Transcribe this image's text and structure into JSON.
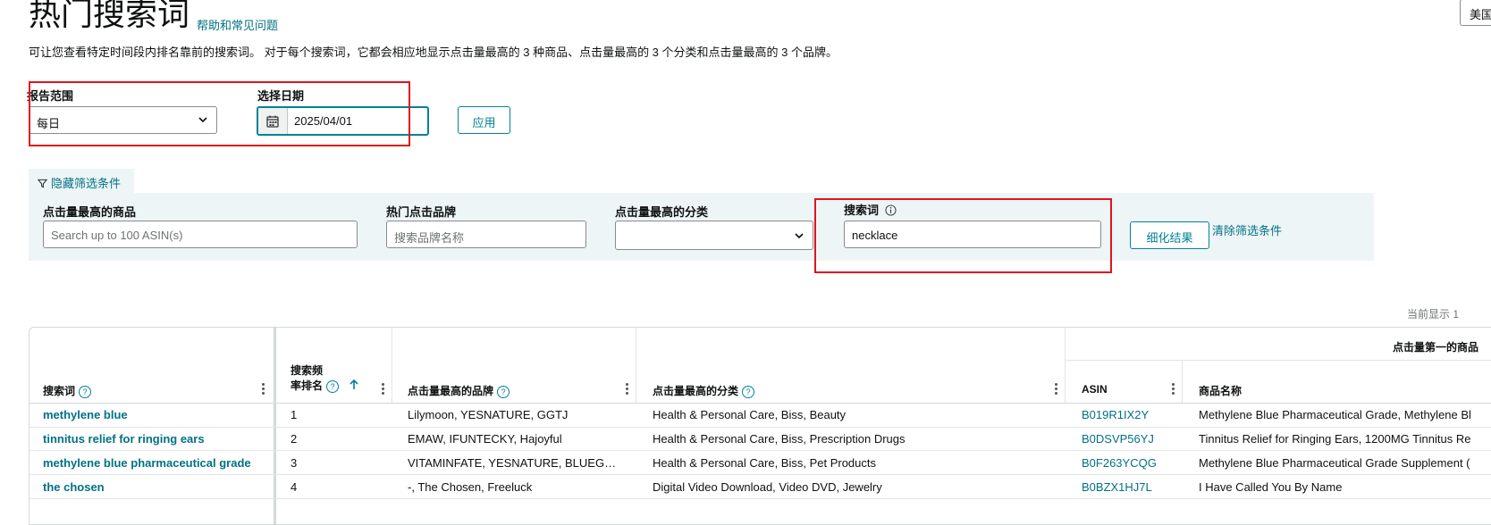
{
  "header": {
    "title": "热门搜索词",
    "help_link": "帮助和常见问题",
    "region_button": "美国",
    "description": "可让您查看特定时间段内排名靠前的搜索词。 对于每个搜索词，它都会相应地显示点击量最高的 3 种商品、点击量最高的 3 个分类和点击量最高的 3 个品牌。"
  },
  "report": {
    "range_label": "报告范围",
    "range_value": "每日",
    "date_label": "选择日期",
    "date_value": "2025/04/01",
    "apply_label": "应用"
  },
  "filters": {
    "toggle_label": "隐藏筛选条件",
    "product_label": "点击量最高的商品",
    "product_placeholder": "Search up to 100 ASIN(s)",
    "brand_label": "热门点击品牌",
    "brand_placeholder": "搜索品牌名称",
    "category_label": "点击量最高的分类",
    "category_value": "",
    "keyword_label": "搜索词",
    "keyword_value": "necklace",
    "refine_label": "细化结果",
    "clear_label": "清除筛选条件"
  },
  "table": {
    "showing_text": "当前显示 1",
    "group_header": "点击量第一的商品",
    "headers": {
      "keyword": "搜索词",
      "rank_line1": "搜索频",
      "rank_line2": "率排名",
      "brand": "点击量最高的品牌",
      "category": "点击量最高的分类",
      "asin": "ASIN",
      "product_name": "商品名称"
    },
    "rows": [
      {
        "keyword": "methylene blue",
        "rank": "1",
        "brands": "Lilymoon, YESNATURE, GGTJ",
        "categories": "Health & Personal Care, Biss, Beauty",
        "asin": "B019R1IX2Y",
        "product": "Methylene Blue Pharmaceutical Grade, Methylene Bl"
      },
      {
        "keyword": "tinnitus relief for ringing ears",
        "rank": "2",
        "brands": "EMAW, IFUNTECKY, Hajoyful",
        "categories": "Health & Personal Care, Biss, Prescription Drugs",
        "asin": "B0DSVP56YJ",
        "product": "Tinnitus Relief for Ringing Ears, 1200MG Tinnitus Re"
      },
      {
        "keyword": "methylene blue pharmaceutical grade",
        "rank": "3",
        "brands": "VITAMINFATE, YESNATURE, BLUEG…",
        "categories": "Health & Personal Care, Biss, Pet Products",
        "asin": "B0F263YCQG",
        "product": "Methylene Blue Pharmaceutical Grade Supplement ("
      },
      {
        "keyword": "the chosen",
        "rank": "4",
        "brands": "-, The Chosen, Freeluck",
        "categories": "Digital Video Download, Video DVD, Jewelry",
        "asin": "B0BZX1HJ7L",
        "product": "I Have Called You By Name"
      }
    ]
  },
  "colors": {
    "accent": "#008296",
    "highlight": "#e0141e",
    "panel": "#eef5f6"
  },
  "icons": [
    "calendar-icon",
    "chevron-down-icon",
    "filter-icon",
    "info-icon",
    "help-icon",
    "sort-up-icon",
    "kebab-icon"
  ]
}
